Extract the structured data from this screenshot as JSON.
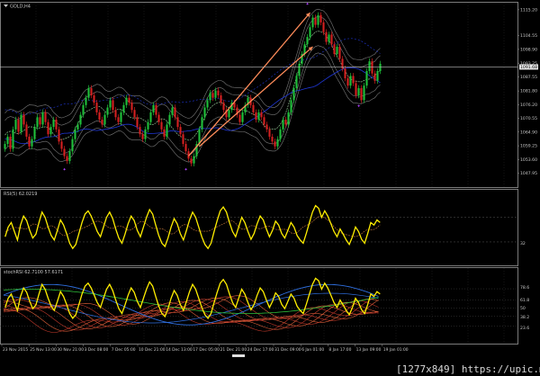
{
  "colors": {
    "background": "#000000",
    "bull": "#1fbf3a",
    "bear": "#d42020",
    "rsi_line": "#ffee00",
    "ma": "#8fbc8f",
    "band": "#7a7a7a",
    "blue": "#1f37d8",
    "orange": "#ff8c5a",
    "arrow_marker": "#b040ff",
    "price_tag": "#e8e8e8"
  },
  "chart_data": [
    {
      "type": "candlestick",
      "title": "GOLD,H4",
      "symbol_icon": "triangle-down-icon",
      "ylim": [
        1043,
        1117
      ],
      "price_axis_ticks": [
        "1115.20",
        "1104.55",
        "1098.90",
        "1093.25",
        "1087.55",
        "1081.80",
        "1076.20",
        "1070.55",
        "1064.90",
        "1059.25",
        "1053.60",
        "1047.95"
      ],
      "current_price_tag": "1091.68",
      "current_price": 1091.68,
      "candles": [
        1060,
        1063,
        1058,
        1066,
        1070,
        1065,
        1072,
        1068,
        1063,
        1059,
        1062,
        1067,
        1071,
        1068,
        1073,
        1069,
        1064,
        1067,
        1070,
        1066,
        1061,
        1058,
        1055,
        1053,
        1057,
        1062,
        1066,
        1068,
        1072,
        1076,
        1079,
        1083,
        1080,
        1077,
        1073,
        1070,
        1068,
        1072,
        1075,
        1078,
        1074,
        1071,
        1069,
        1073,
        1076,
        1079,
        1077,
        1074,
        1071,
        1067,
        1064,
        1062,
        1066,
        1069,
        1073,
        1076,
        1072,
        1069,
        1066,
        1063,
        1068,
        1072,
        1075,
        1071,
        1067,
        1064,
        1060,
        1057,
        1054,
        1052,
        1055,
        1060,
        1066,
        1071,
        1075,
        1078,
        1081,
        1079,
        1082,
        1080,
        1077,
        1074,
        1071,
        1074,
        1077,
        1075,
        1072,
        1069,
        1073,
        1076,
        1079,
        1076,
        1073,
        1070,
        1073,
        1071,
        1068,
        1066,
        1063,
        1061,
        1059,
        1062,
        1066,
        1070,
        1068,
        1073,
        1078,
        1083,
        1088,
        1093,
        1097,
        1101,
        1104,
        1108,
        1112,
        1109,
        1113,
        1110,
        1106,
        1102,
        1105,
        1101,
        1097,
        1100,
        1095,
        1091,
        1087,
        1084,
        1088,
        1085,
        1080,
        1083,
        1078,
        1084,
        1090,
        1094,
        1089,
        1086,
        1090,
        1093
      ],
      "arrows": [
        {
          "from_index": 68,
          "from_value": 1055,
          "to_index": 113,
          "to_value": 1114
        },
        {
          "from_index": 72,
          "from_value": 1059,
          "to_index": 114,
          "to_value": 1100
        }
      ]
    },
    {
      "type": "line",
      "title": "RSI(5) 62.0219",
      "ylim": [
        0,
        100
      ],
      "axis_ticks": [
        "32"
      ],
      "values": [
        40,
        55,
        62,
        48,
        35,
        58,
        72,
        65,
        50,
        38,
        44,
        62,
        78,
        70,
        55,
        42,
        35,
        50,
        66,
        58,
        45,
        30,
        22,
        28,
        45,
        62,
        75,
        80,
        72,
        60,
        48,
        40,
        55,
        70,
        78,
        68,
        52,
        38,
        30,
        44,
        60,
        72,
        65,
        50,
        40,
        55,
        70,
        82,
        75,
        58,
        42,
        30,
        25,
        38,
        55,
        68,
        60,
        45,
        35,
        50,
        66,
        78,
        70,
        55,
        40,
        28,
        22,
        30,
        48,
        65,
        80,
        86,
        78,
        62,
        48,
        40,
        55,
        70,
        62,
        48,
        36,
        45,
        60,
        72,
        66,
        52,
        40,
        50,
        64,
        58,
        45,
        38,
        50,
        62,
        55,
        42,
        35,
        30,
        45,
        62,
        78,
        88,
        84,
        70,
        80,
        72,
        60,
        48,
        40,
        52,
        44,
        35,
        28,
        40,
        55,
        48,
        36,
        30,
        45,
        62,
        58,
        66,
        62
      ],
      "series": [
        {
          "values_ref": "values"
        }
      ]
    },
    {
      "type": "line",
      "title": "stochRSI 62.7100 57.6171",
      "ylim": [
        0,
        100
      ],
      "axis_ticks": [
        "78.6",
        "61.8",
        "50",
        "38.2",
        "23.6"
      ]
    }
  ],
  "x_axis_dates": [
    "23 Nov 2015",
    "25 Nov 13:00",
    "30 Nov 21:00",
    "3 Dec 08:00",
    "7 Dec 05:00",
    "10 Dec 21:00",
    "14 Dec 13:00",
    "17 Dec 05:00",
    "21 Dec 21:00",
    "24 Dec 17:00",
    "31 Dec 09:00",
    "6 Jan 01:00",
    "8 Jan 17:00",
    "13 Jan 09:00",
    "19 Jan 01:00"
  ],
  "watermark": "[1277x849] https://upic.me/"
}
